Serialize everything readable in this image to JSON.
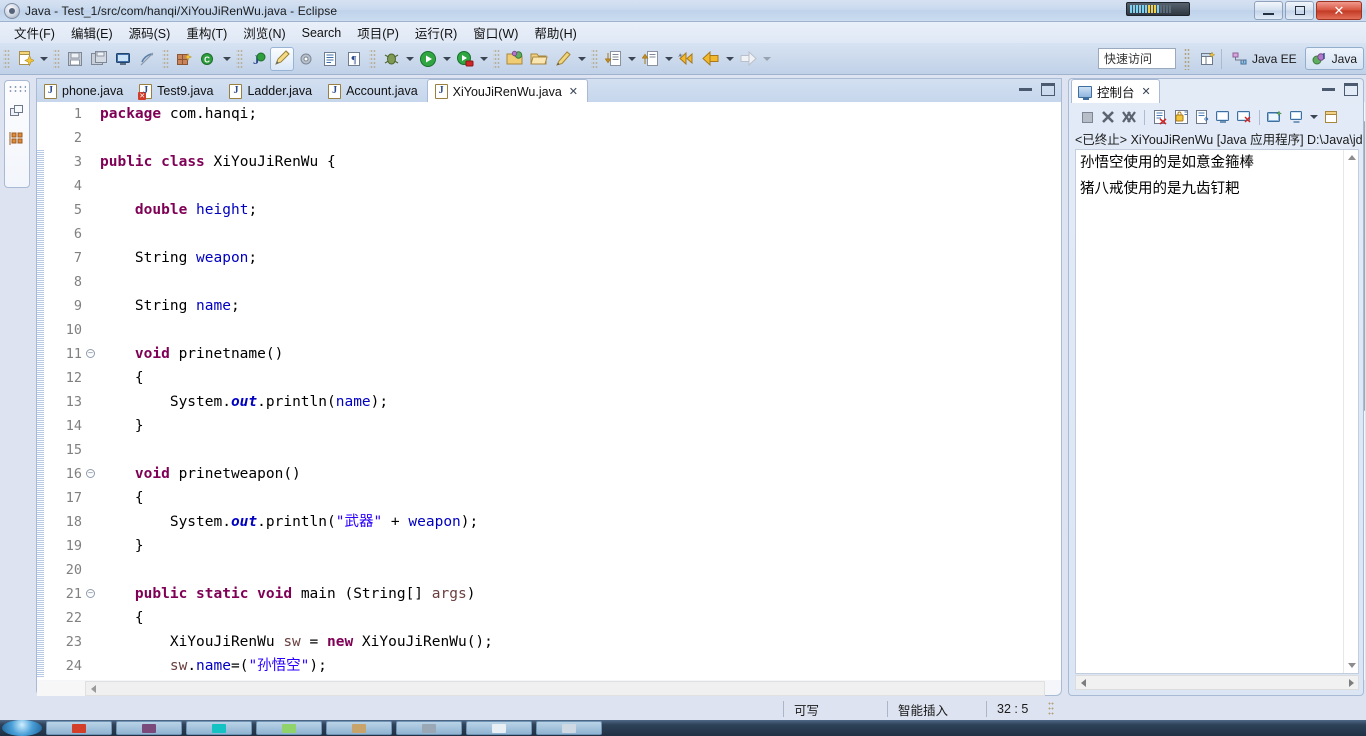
{
  "window": {
    "title": "Java - Test_1/src/com/hanqi/XiYouJiRenWu.java - Eclipse",
    "minimize_label": "",
    "restore_label": "",
    "close_label": "✕"
  },
  "menubar": {
    "items": [
      {
        "label": "文件(F)"
      },
      {
        "label": "编辑(E)"
      },
      {
        "label": "源码(S)"
      },
      {
        "label": "重构(T)"
      },
      {
        "label": "浏览(N)"
      },
      {
        "label": "Search"
      },
      {
        "label": "项目(P)"
      },
      {
        "label": "运行(R)"
      },
      {
        "label": "窗口(W)"
      },
      {
        "label": "帮助(H)"
      }
    ]
  },
  "toolbar": {
    "quick_access_placeholder": "快速访问",
    "quick_access_value": "",
    "buttons": [
      {
        "name": "new-wizard",
        "glyph": "📄"
      },
      {
        "name": "save",
        "glyph": "💾"
      },
      {
        "name": "save-all",
        "glyph": "🗐"
      },
      {
        "name": "print",
        "glyph": "🖥"
      },
      {
        "name": "link-disabled",
        "glyph": "🚫"
      },
      {
        "name": "new-java-package",
        "glyph": "📦"
      },
      {
        "name": "new-class",
        "glyph": "C"
      },
      {
        "name": "open-type",
        "glyph": "T"
      },
      {
        "name": "open-task",
        "glyph": "✎"
      },
      {
        "name": "external-tools",
        "glyph": "⚙"
      },
      {
        "name": "toggle-block",
        "glyph": "▤"
      },
      {
        "name": "toggle-whitespace",
        "glyph": "¶"
      },
      {
        "name": "debug",
        "glyph": "🐞"
      },
      {
        "name": "run",
        "glyph": "▶"
      },
      {
        "name": "coverage",
        "glyph": "▶"
      },
      {
        "name": "new-java-project",
        "glyph": "📂"
      },
      {
        "name": "open-folder",
        "glyph": "📁"
      },
      {
        "name": "annotate",
        "glyph": "✏"
      },
      {
        "name": "next-annotation",
        "glyph": "⬇"
      },
      {
        "name": "previous-annotation",
        "glyph": "⬆"
      },
      {
        "name": "last-edit-location",
        "glyph": "⬅"
      },
      {
        "name": "back",
        "glyph": "⬅"
      },
      {
        "name": "forward",
        "glyph": "➡"
      }
    ],
    "perspectives": [
      {
        "label": "Java EE",
        "active": false
      },
      {
        "label": "Java",
        "active": true
      }
    ]
  },
  "left_rail": {
    "items": [
      {
        "name": "package-explorer",
        "glyph": "❏"
      },
      {
        "name": "outline-view",
        "glyph": "▦"
      }
    ]
  },
  "editor": {
    "tabs": [
      {
        "label": "phone.java",
        "active": false,
        "error": false
      },
      {
        "label": "Test9.java",
        "active": false,
        "error": true
      },
      {
        "label": "Ladder.java",
        "active": false,
        "error": false
      },
      {
        "label": "Account.java",
        "active": false,
        "error": false
      },
      {
        "label": "XiYouJiRenWu.java",
        "active": true,
        "error": false,
        "close": "✕"
      }
    ],
    "lines": [
      {
        "n": "1",
        "fold": false,
        "changed": false,
        "tokens": [
          {
            "t": "package",
            "c": "kw"
          },
          {
            "t": " com.hanqi;",
            "c": ""
          }
        ]
      },
      {
        "n": "2",
        "fold": false,
        "changed": false,
        "tokens": []
      },
      {
        "n": "3",
        "fold": false,
        "changed": true,
        "tokens": [
          {
            "t": "public",
            "c": "kw"
          },
          {
            "t": " ",
            "c": ""
          },
          {
            "t": "class",
            "c": "kw"
          },
          {
            "t": " XiYouJiRenWu {",
            "c": ""
          }
        ]
      },
      {
        "n": "4",
        "fold": false,
        "changed": true,
        "tokens": []
      },
      {
        "n": "5",
        "fold": false,
        "changed": true,
        "tokens": [
          {
            "t": "    ",
            "c": ""
          },
          {
            "t": "double",
            "c": "kw"
          },
          {
            "t": " ",
            "c": ""
          },
          {
            "t": "height",
            "c": "fld"
          },
          {
            "t": ";",
            "c": ""
          }
        ]
      },
      {
        "n": "6",
        "fold": false,
        "changed": true,
        "tokens": []
      },
      {
        "n": "7",
        "fold": false,
        "changed": true,
        "tokens": [
          {
            "t": "    String ",
            "c": ""
          },
          {
            "t": "weapon",
            "c": "fld"
          },
          {
            "t": ";",
            "c": ""
          }
        ]
      },
      {
        "n": "8",
        "fold": false,
        "changed": true,
        "tokens": []
      },
      {
        "n": "9",
        "fold": false,
        "changed": true,
        "tokens": [
          {
            "t": "    String ",
            "c": ""
          },
          {
            "t": "name",
            "c": "fld"
          },
          {
            "t": ";",
            "c": ""
          }
        ]
      },
      {
        "n": "10",
        "fold": false,
        "changed": true,
        "tokens": []
      },
      {
        "n": "11",
        "fold": true,
        "changed": true,
        "tokens": [
          {
            "t": "    ",
            "c": ""
          },
          {
            "t": "void",
            "c": "kw"
          },
          {
            "t": " prinetname()",
            "c": ""
          }
        ]
      },
      {
        "n": "12",
        "fold": false,
        "changed": true,
        "tokens": [
          {
            "t": "    {",
            "c": ""
          }
        ]
      },
      {
        "n": "13",
        "fold": false,
        "changed": true,
        "tokens": [
          {
            "t": "        System.",
            "c": ""
          },
          {
            "t": "out",
            "c": "stat"
          },
          {
            "t": ".println(",
            "c": ""
          },
          {
            "t": "name",
            "c": "fld"
          },
          {
            "t": ");",
            "c": ""
          }
        ]
      },
      {
        "n": "14",
        "fold": false,
        "changed": true,
        "tokens": [
          {
            "t": "    }",
            "c": ""
          }
        ]
      },
      {
        "n": "15",
        "fold": false,
        "changed": true,
        "tokens": []
      },
      {
        "n": "16",
        "fold": true,
        "changed": true,
        "tokens": [
          {
            "t": "    ",
            "c": ""
          },
          {
            "t": "void",
            "c": "kw"
          },
          {
            "t": " prinetweapon()",
            "c": ""
          }
        ]
      },
      {
        "n": "17",
        "fold": false,
        "changed": true,
        "tokens": [
          {
            "t": "    {",
            "c": ""
          }
        ]
      },
      {
        "n": "18",
        "fold": false,
        "changed": true,
        "tokens": [
          {
            "t": "        System.",
            "c": ""
          },
          {
            "t": "out",
            "c": "stat"
          },
          {
            "t": ".println(",
            "c": ""
          },
          {
            "t": "\"武器\"",
            "c": "str"
          },
          {
            "t": " + ",
            "c": ""
          },
          {
            "t": "weapon",
            "c": "fld"
          },
          {
            "t": ");",
            "c": ""
          }
        ]
      },
      {
        "n": "19",
        "fold": false,
        "changed": true,
        "tokens": [
          {
            "t": "    }",
            "c": ""
          }
        ]
      },
      {
        "n": "20",
        "fold": false,
        "changed": true,
        "tokens": []
      },
      {
        "n": "21",
        "fold": true,
        "changed": true,
        "tokens": [
          {
            "t": "    ",
            "c": ""
          },
          {
            "t": "public",
            "c": "kw"
          },
          {
            "t": " ",
            "c": ""
          },
          {
            "t": "static",
            "c": "kw"
          },
          {
            "t": " ",
            "c": ""
          },
          {
            "t": "void",
            "c": "kw"
          },
          {
            "t": " main (String[] ",
            "c": ""
          },
          {
            "t": "args",
            "c": "loc"
          },
          {
            "t": ")",
            "c": ""
          }
        ]
      },
      {
        "n": "22",
        "fold": false,
        "changed": true,
        "tokens": [
          {
            "t": "    {",
            "c": ""
          }
        ]
      },
      {
        "n": "23",
        "fold": false,
        "changed": true,
        "tokens": [
          {
            "t": "        XiYouJiRenWu ",
            "c": ""
          },
          {
            "t": "sw",
            "c": "loc"
          },
          {
            "t": " = ",
            "c": ""
          },
          {
            "t": "new",
            "c": "kw"
          },
          {
            "t": " XiYouJiRenWu();",
            "c": ""
          }
        ]
      },
      {
        "n": "24",
        "fold": false,
        "changed": true,
        "tokens": [
          {
            "t": "        ",
            "c": ""
          },
          {
            "t": "sw",
            "c": "loc"
          },
          {
            "t": ".",
            "c": ""
          },
          {
            "t": "name",
            "c": "fld"
          },
          {
            "t": "=(",
            "c": ""
          },
          {
            "t": "\"孙悟空\"",
            "c": "str"
          },
          {
            "t": ");",
            "c": ""
          }
        ]
      }
    ]
  },
  "console": {
    "tab_label": "控制台",
    "tab_close": "✕",
    "toolbar_buttons": [
      {
        "name": "terminate",
        "glyph": "■"
      },
      {
        "name": "remove-launch",
        "glyph": "✖"
      },
      {
        "name": "remove-all-terminated",
        "glyph": "✖"
      },
      {
        "name": "clear-console",
        "glyph": "▤"
      },
      {
        "name": "scroll-lock",
        "glyph": "🔒"
      },
      {
        "name": "word-wrap",
        "glyph": "▤"
      },
      {
        "name": "pin-console",
        "glyph": "▭"
      },
      {
        "name": "display-selected-console",
        "glyph": "▭"
      },
      {
        "name": "open-console",
        "glyph": "▭"
      },
      {
        "name": "view-menu",
        "glyph": "▭"
      },
      {
        "name": "minimize",
        "glyph": "▭"
      }
    ],
    "header": "<已终止> XiYouJiRenWu [Java 应用程序] D:\\Java\\jd",
    "output": [
      "孙悟空使用的是如意金箍棒",
      "猪八戒使用的是九齿钉耙"
    ]
  },
  "statusbar": {
    "writable": "可写",
    "insert_mode": "智能插入",
    "cursor_position": "32 : 5"
  },
  "taskbar": {
    "items": [
      {
        "name": "taskbar-item-1",
        "color": "#d43f2a"
      },
      {
        "name": "taskbar-item-2",
        "color": "#7a4a7a"
      },
      {
        "name": "taskbar-item-3",
        "color": "#13c3c3"
      },
      {
        "name": "taskbar-item-4",
        "color": "#8fd36a"
      },
      {
        "name": "taskbar-item-5",
        "color": "#c8a46a"
      },
      {
        "name": "taskbar-item-6",
        "color": "#9aa7b4"
      },
      {
        "name": "taskbar-item-7",
        "color": "#e8f0f6"
      },
      {
        "name": "taskbar-item-8",
        "color": "#cfd9e4"
      }
    ]
  }
}
